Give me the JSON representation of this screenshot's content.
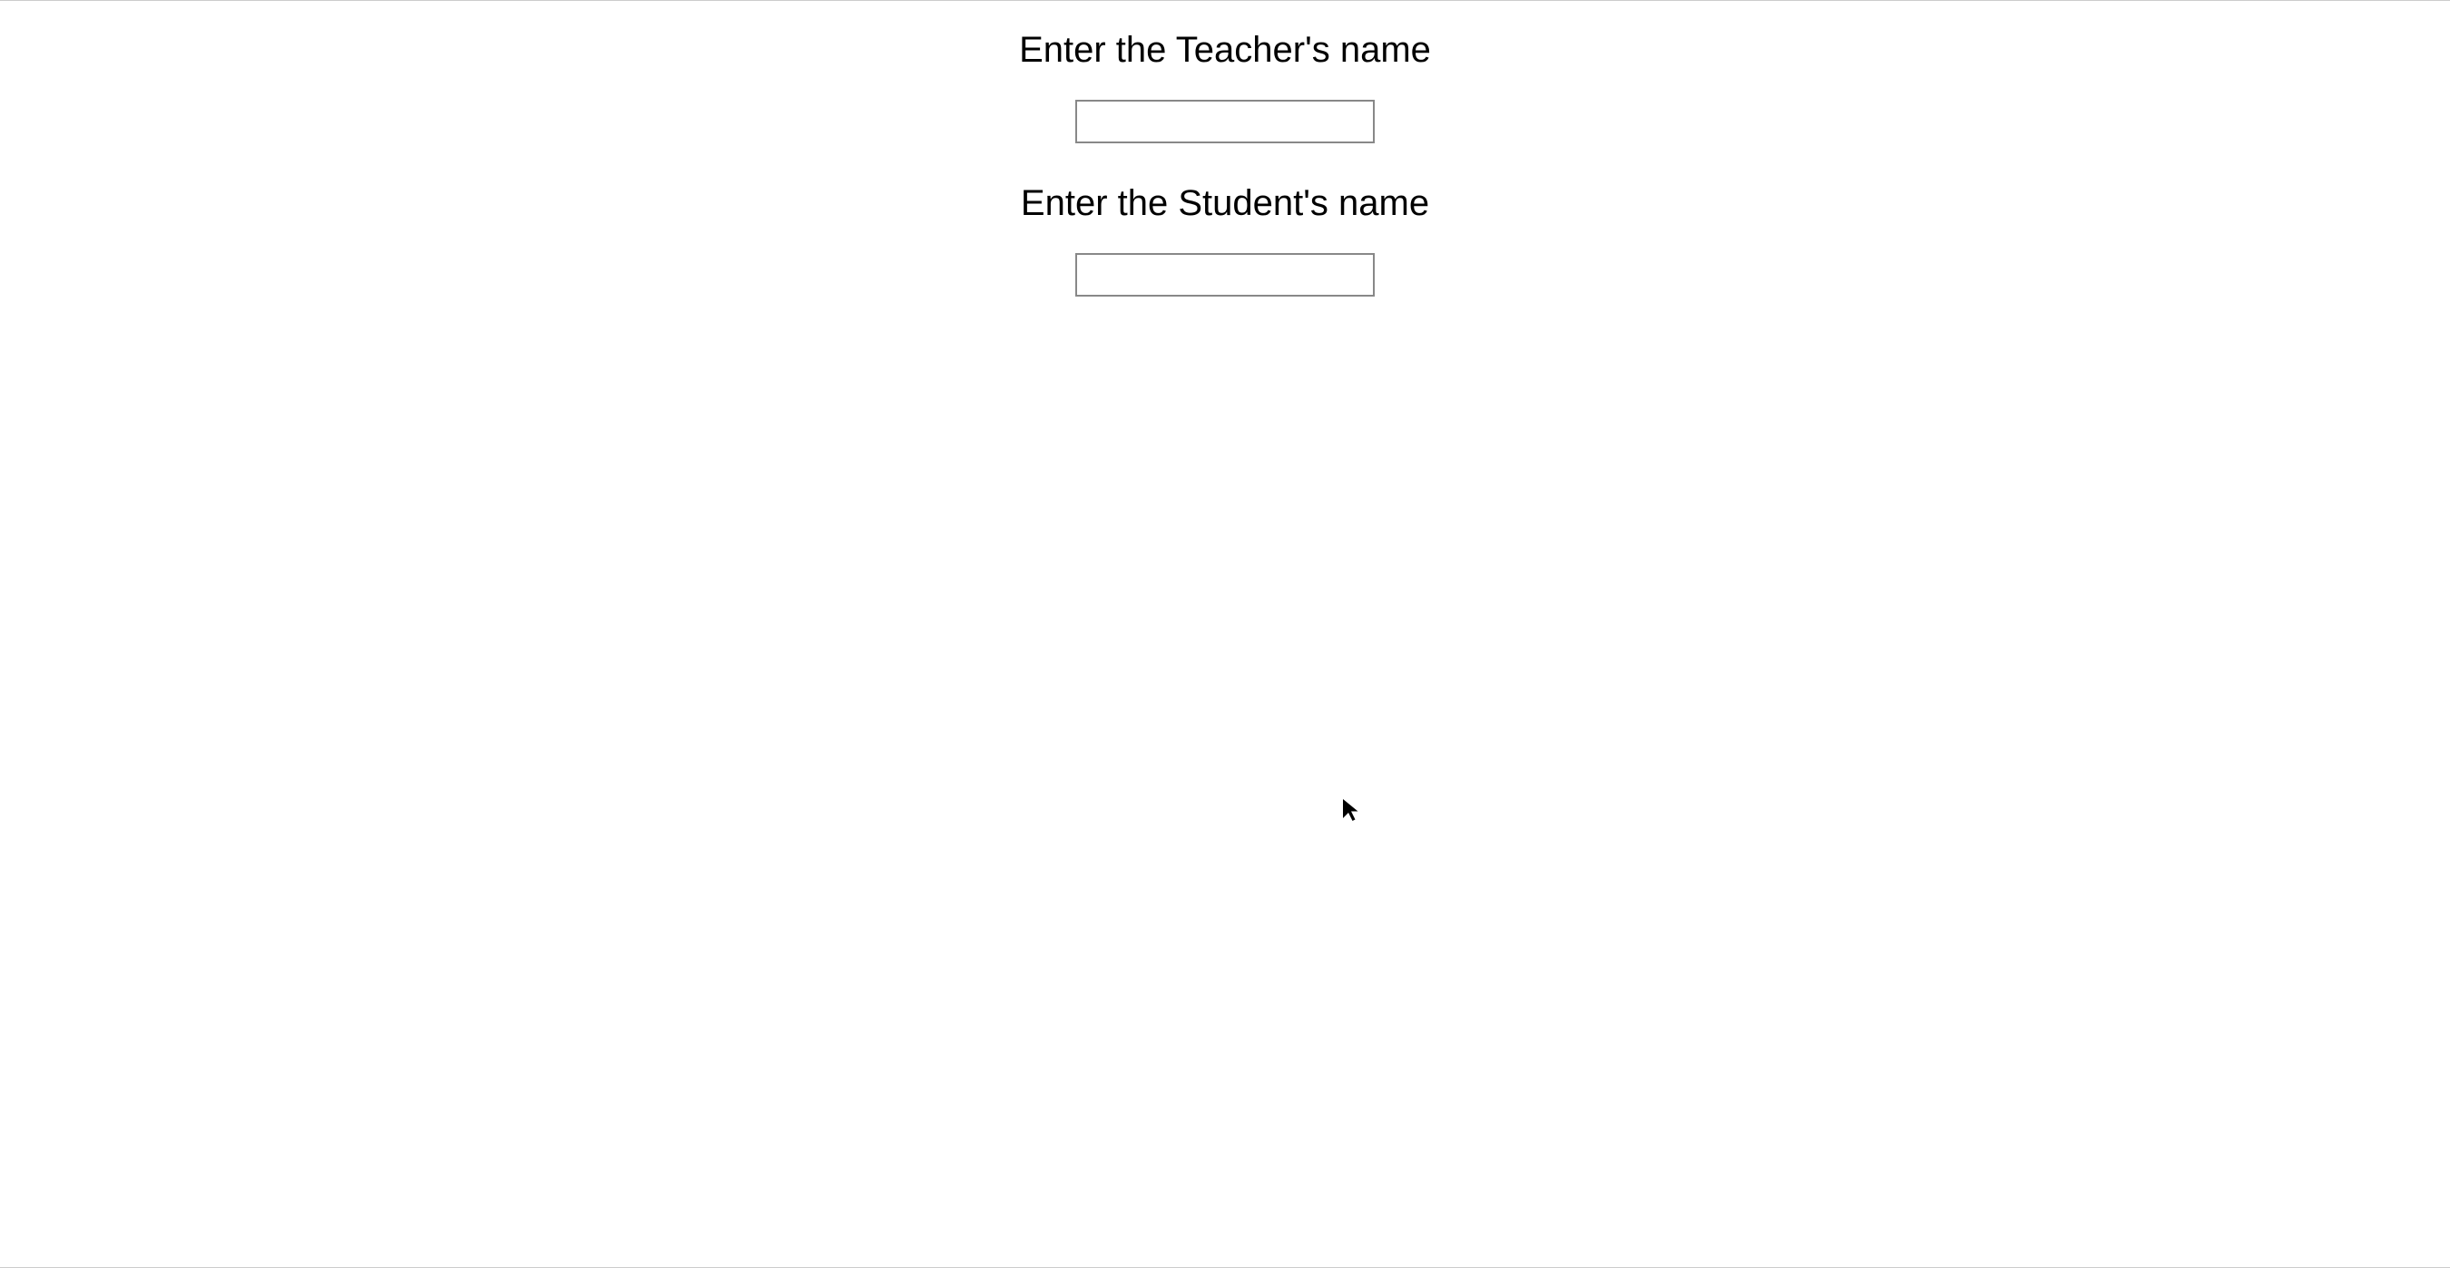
{
  "form": {
    "teacher": {
      "label": "Enter the Teacher's name",
      "value": ""
    },
    "student": {
      "label": "Enter the Student's name",
      "value": ""
    }
  }
}
